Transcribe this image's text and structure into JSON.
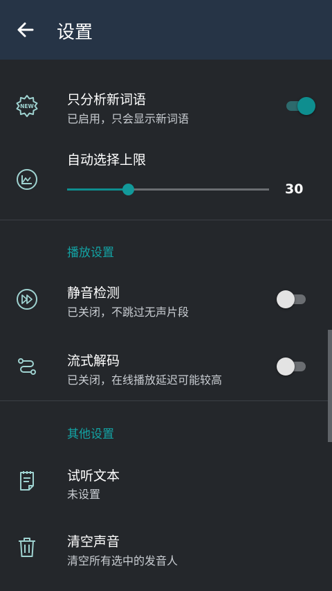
{
  "header": {
    "title": "设置",
    "back_icon": "arrow-left-icon",
    "background": "#263446"
  },
  "settings": {
    "new_words": {
      "title": "只分析新词语",
      "subtitle": "已启用，只会显示新词语",
      "icon": "new-badge-icon",
      "enabled": true
    },
    "auto_select": {
      "title": "自动选择上限",
      "icon": "chart-circle-icon",
      "value": "30",
      "min": 0,
      "max": 100,
      "fill_fraction": 0.3
    },
    "playback_section": "播放设置",
    "silence": {
      "title": "静音检测",
      "subtitle": "已关闭，不跳过无声片段",
      "icon": "fast-forward-circle-icon",
      "enabled": false
    },
    "streaming": {
      "title": "流式解码",
      "subtitle": "已关闭，在线播放延迟可能较高",
      "icon": "route-icon",
      "enabled": false
    },
    "other_section": "其他设置",
    "sample_text": {
      "title": "试听文本",
      "subtitle": "未设置",
      "icon": "notepad-icon"
    },
    "clear_voices": {
      "title": "清空声音",
      "subtitle": "清空所有选中的发音人",
      "icon": "trash-icon"
    }
  },
  "colors": {
    "accent": "#0e8e8f",
    "background": "#24272b",
    "section_text": "#13a3a4"
  }
}
